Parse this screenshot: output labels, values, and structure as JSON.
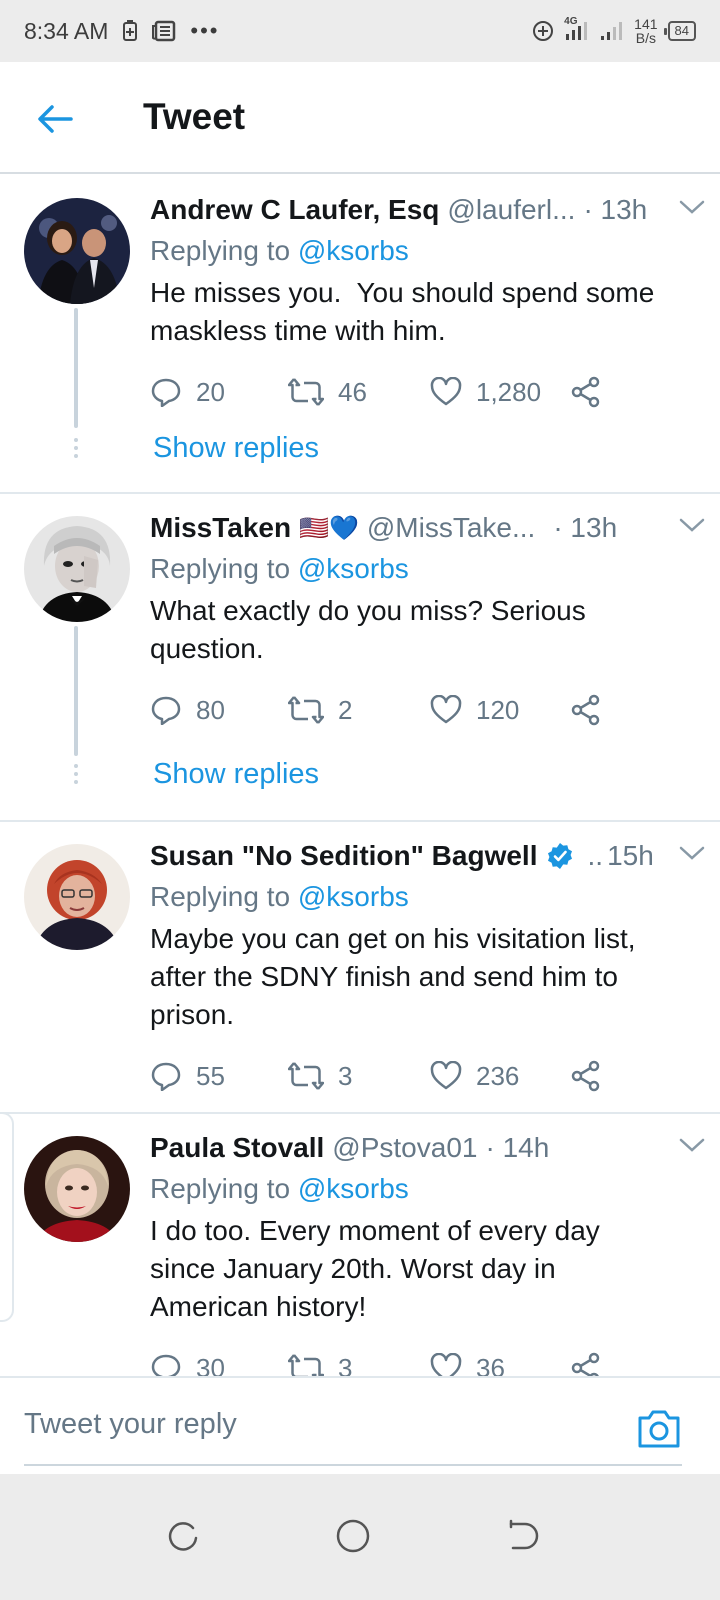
{
  "status_bar": {
    "time": "8:34 AM",
    "more": "•••",
    "network": "4G",
    "speed_value": "141",
    "speed_unit": "B/s",
    "battery": "84"
  },
  "header": {
    "title": "Tweet"
  },
  "colors": {
    "accent": "#1b95e0",
    "secondary_text": "#657786",
    "divider": "#e1e8ed"
  },
  "tweets": [
    {
      "display_name": "Andrew C Laufer, Esq",
      "handle": "@lauferl...",
      "time": "· 13h",
      "replying_prefix": "Replying to",
      "replying_to": "@ksorbs",
      "text_lines": [
        "He misses you.  You should spend some",
        "maskless time with him."
      ],
      "replies": "20",
      "retweets": "46",
      "likes": "1,280",
      "show_replies": "Show replies"
    },
    {
      "display_name": "MissTaken",
      "flag": "🇺🇸",
      "heart": "💙",
      "handle": "@MissTake...",
      "time": "· 13h",
      "replying_prefix": "Replying to",
      "replying_to": "@ksorbs",
      "text_lines": [
        "What exactly do you miss? Serious",
        "question."
      ],
      "replies": "80",
      "retweets": "2",
      "likes": "120",
      "show_replies": "Show replies"
    },
    {
      "display_name": "Susan \"No Sedition\" Bagwell",
      "handle": "..",
      "time": "15h",
      "replying_prefix": "Replying to",
      "replying_to": "@ksorbs",
      "text_lines": [
        "Maybe you can get on his visitation list,",
        "after the SDNY finish and send him to",
        "prison."
      ],
      "replies": "55",
      "retweets": "3",
      "likes": "236"
    },
    {
      "display_name": "Paula Stovall",
      "handle": "@Pstova01",
      "time": "· 14h",
      "replying_prefix": "Replying to",
      "replying_to": "@ksorbs",
      "text_lines": [
        "I do too. Every moment of every day",
        "since January 20th. Worst day in",
        "American history!"
      ],
      "replies": "30",
      "retweets": "3",
      "likes": "36"
    }
  ],
  "reply_bar": {
    "placeholder": "Tweet your reply"
  }
}
